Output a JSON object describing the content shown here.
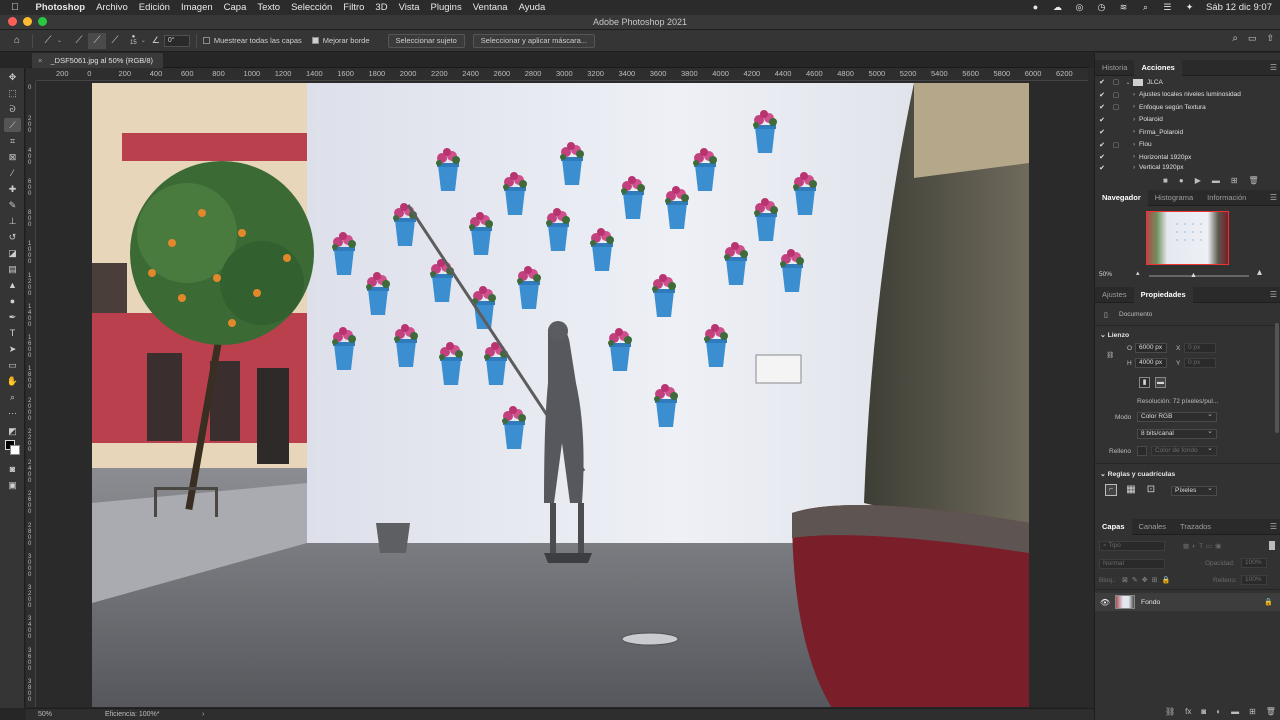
{
  "menubar": {
    "app": "Photoshop",
    "items": [
      "Archivo",
      "Edición",
      "Imagen",
      "Capa",
      "Texto",
      "Selección",
      "Filtro",
      "3D",
      "Vista",
      "Plugins",
      "Ventana",
      "Ayuda"
    ],
    "clock": "Sáb 12 dic  9:07"
  },
  "window": {
    "title": "Adobe Photoshop 2021"
  },
  "options": {
    "brush_size": "15",
    "angle": "0°",
    "sample_all_layers": "Muestrear todas las capas",
    "sample_all_checked": false,
    "enhance_edge": "Mejorar borde",
    "enhance_edge_checked": true,
    "select_subject": "Seleccionar sujeto",
    "select_and_mask": "Seleccionar y aplicar máscara..."
  },
  "document": {
    "tab_label": "_DSF5061.jpg al 50% (RGB/8)"
  },
  "ruler": {
    "h_labels": [
      "200",
      "0",
      "200",
      "400",
      "600",
      "800",
      "1000",
      "1200",
      "1400",
      "1600",
      "1800",
      "2000",
      "2200",
      "2400",
      "2600",
      "2800",
      "3000",
      "3200",
      "3400",
      "3600",
      "3800",
      "4000",
      "4200",
      "4400",
      "4600",
      "4800",
      "5000",
      "5200",
      "5400",
      "5600",
      "5800",
      "6000",
      "6200"
    ],
    "v_labels": [
      "0",
      "2 0 0",
      "4 0 0",
      "6 0 0",
      "8 0 0",
      "1 0 0 0",
      "1 2 0 0",
      "1 4 0 0",
      "1 6 0 0",
      "1 8 0 0",
      "2 0 0 0",
      "2 2 0 0",
      "2 4 0 0",
      "2 6 0 0",
      "2 8 0 0",
      "3 0 0 0",
      "3 2 0 0",
      "3 4 0 0",
      "3 6 0 0",
      "3 8 0 0"
    ]
  },
  "status": {
    "zoom": "50%",
    "efficiency": "Eficiencia: 100%*"
  },
  "history_panel": {
    "tabs": [
      "Historia",
      "Acciones"
    ],
    "active_tab": "Acciones",
    "set_name": "JLCA",
    "actions": [
      {
        "label": "Ajustes locales niveles luminosidad",
        "dialog": true
      },
      {
        "label": "Enfoque según Textura",
        "dialog": true
      },
      {
        "label": "Polaroid",
        "dialog": false
      },
      {
        "label": "Firma_Polaroid",
        "dialog": false
      },
      {
        "label": "Flou",
        "dialog": true
      },
      {
        "label": "Horizontal 1920px",
        "dialog": false
      },
      {
        "label": "Vertical 1920px",
        "dialog": false
      }
    ]
  },
  "navigator_panel": {
    "tabs": [
      "Navegador",
      "Histograma",
      "Información"
    ],
    "active_tab": "Navegador",
    "zoom": "50%"
  },
  "properties_panel": {
    "tabs": [
      "Ajustes",
      "Propiedades"
    ],
    "active_tab": "Propiedades",
    "doc_label": "Documento",
    "canvas_section": "Lienzo",
    "width_label": "O",
    "width_value": "6000 px",
    "x_label": "X",
    "height_label": "H",
    "height_value": "4000 px",
    "y_label": "Y",
    "x_placeholder": "0 px",
    "y_placeholder": "0 px",
    "resolution": "Resolución: 72 píxeles/pul...",
    "mode_label": "Modo",
    "mode_value": "Color RGB",
    "bits_value": "8 bits/canal",
    "fill_label": "Relleno",
    "fill_value": "Color de fondo",
    "rulers_section": "Reglas y cuadrículas",
    "units_value": "Píxeles"
  },
  "layers_panel": {
    "tabs": [
      "Capas",
      "Canales",
      "Trazados"
    ],
    "active_tab": "Capas",
    "filter_label": "Tipo",
    "blend_mode": "Normal",
    "opacity_label": "Opacidad:",
    "opacity_value": "100%",
    "lock_label": "Bloq.:",
    "fill_label": "Relleno:",
    "fill_value": "100%",
    "layers": [
      {
        "name": "Fondo",
        "visible": true,
        "locked": true
      }
    ]
  }
}
